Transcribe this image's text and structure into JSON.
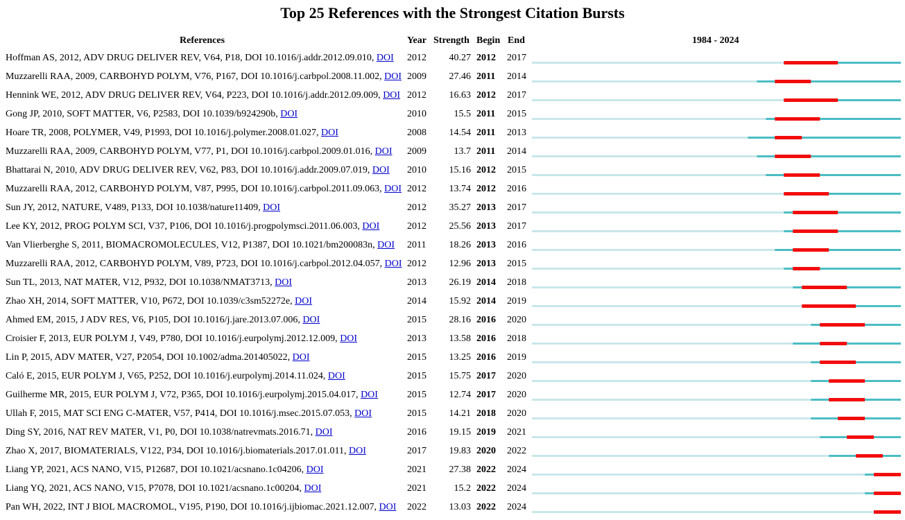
{
  "title": "Top 25 References with the Strongest Citation Bursts",
  "headers": {
    "references": "References",
    "year": "Year",
    "strength": "Strength",
    "begin": "Begin",
    "end": "End",
    "range": "1984 - 2024"
  },
  "colors": {
    "base": "#c9e7ea",
    "active": "#4bbdc4",
    "burst": "#f20d0d",
    "link": "#0000cc"
  },
  "chart_data": {
    "type": "table",
    "range": [
      1984,
      2024
    ],
    "rows": [
      {
        "ref": "Hoffman AS, 2012, ADV DRUG DELIVER REV, V64, P18, DOI 10.1016/j.addr.2012.09.010,",
        "link": "DOI",
        "year": "2012",
        "strength": "40.27",
        "begin": "2012",
        "end": "2017"
      },
      {
        "ref": "Muzzarelli RAA, 2009, CARBOHYD POLYM, V76, P167, DOI 10.1016/j.carbpol.2008.11.002,",
        "link": "DOI",
        "year": "2009",
        "strength": "27.46",
        "begin": "2011",
        "end": "2014"
      },
      {
        "ref": "Hennink WE, 2012, ADV DRUG DELIVER REV, V64, P223, DOI 10.1016/j.addr.2012.09.009,",
        "link": "DOI",
        "year": "2012",
        "strength": "16.63",
        "begin": "2012",
        "end": "2017"
      },
      {
        "ref": "Gong JP, 2010, SOFT MATTER, V6, P2583, DOI 10.1039/b924290b,",
        "link": "DOI",
        "year": "2010",
        "strength": "15.5",
        "begin": "2011",
        "end": "2015"
      },
      {
        "ref": "Hoare TR, 2008, POLYMER, V49, P1993, DOI 10.1016/j.polymer.2008.01.027,",
        "link": "DOI",
        "year": "2008",
        "strength": "14.54",
        "begin": "2011",
        "end": "2013"
      },
      {
        "ref": "Muzzarelli RAA, 2009, CARBOHYD POLYM, V77, P1, DOI 10.1016/j.carbpol.2009.01.016,",
        "link": "DOI",
        "year": "2009",
        "strength": "13.7",
        "begin": "2011",
        "end": "2014"
      },
      {
        "ref": "Bhattarai N, 2010, ADV DRUG DELIVER REV, V62, P83, DOI 10.1016/j.addr.2009.07.019,",
        "link": "DOI",
        "year": "2010",
        "strength": "15.16",
        "begin": "2012",
        "end": "2015"
      },
      {
        "ref": "Muzzarelli RAA, 2012, CARBOHYD POLYM, V87, P995, DOI 10.1016/j.carbpol.2011.09.063,",
        "link": "DOI",
        "year": "2012",
        "strength": "13.74",
        "begin": "2012",
        "end": "2016"
      },
      {
        "ref": "Sun JY, 2012, NATURE, V489, P133, DOI 10.1038/nature11409,",
        "link": "DOI",
        "year": "2012",
        "strength": "35.27",
        "begin": "2013",
        "end": "2017"
      },
      {
        "ref": "Lee KY, 2012, PROG POLYM SCI, V37, P106, DOI 10.1016/j.progpolymsci.2011.06.003,",
        "link": "DOI",
        "year": "2012",
        "strength": "25.56",
        "begin": "2013",
        "end": "2017"
      },
      {
        "ref": "Van Vlierberghe S, 2011, BIOMACROMOLECULES, V12, P1387, DOI 10.1021/bm200083n,",
        "link": "DOI",
        "year": "2011",
        "strength": "18.26",
        "begin": "2013",
        "end": "2016"
      },
      {
        "ref": "Muzzarelli RAA, 2012, CARBOHYD POLYM, V89, P723, DOI 10.1016/j.carbpol.2012.04.057,",
        "link": "DOI",
        "year": "2012",
        "strength": "12.96",
        "begin": "2013",
        "end": "2015"
      },
      {
        "ref": "Sun TL, 2013, NAT MATER, V12, P932, DOI 10.1038/NMAT3713,",
        "link": "DOI",
        "year": "2013",
        "strength": "26.19",
        "begin": "2014",
        "end": "2018"
      },
      {
        "ref": "Zhao XH, 2014, SOFT MATTER, V10, P672, DOI 10.1039/c3sm52272e,",
        "link": "DOI",
        "year": "2014",
        "strength": "15.92",
        "begin": "2014",
        "end": "2019"
      },
      {
        "ref": "Ahmed EM, 2015, J ADV RES, V6, P105, DOI 10.1016/j.jare.2013.07.006,",
        "link": "DOI",
        "year": "2015",
        "strength": "28.16",
        "begin": "2016",
        "end": "2020"
      },
      {
        "ref": "Croisier F, 2013, EUR POLYM J, V49, P780, DOI 10.1016/j.eurpolymj.2012.12.009,",
        "link": "DOI",
        "year": "2013",
        "strength": "13.58",
        "begin": "2016",
        "end": "2018"
      },
      {
        "ref": "Lin P, 2015, ADV MATER, V27, P2054, DOI 10.1002/adma.201405022,",
        "link": "DOI",
        "year": "2015",
        "strength": "13.25",
        "begin": "2016",
        "end": "2019"
      },
      {
        "ref": "Caló E, 2015, EUR POLYM J, V65, P252, DOI 10.1016/j.eurpolymj.2014.11.024,",
        "link": "DOI",
        "year": "2015",
        "strength": "15.75",
        "begin": "2017",
        "end": "2020"
      },
      {
        "ref": "Guilherme MR, 2015, EUR POLYM J, V72, P365, DOI 10.1016/j.eurpolymj.2015.04.017,",
        "link": "DOI",
        "year": "2015",
        "strength": "12.74",
        "begin": "2017",
        "end": "2020"
      },
      {
        "ref": "Ullah F, 2015, MAT SCI ENG C-MATER, V57, P414, DOI 10.1016/j.msec.2015.07.053,",
        "link": "DOI",
        "year": "2015",
        "strength": "14.21",
        "begin": "2018",
        "end": "2020"
      },
      {
        "ref": "Ding SY, 2016, NAT REV MATER, V1, P0, DOI 10.1038/natrevmats.2016.71,",
        "link": "DOI",
        "year": "2016",
        "strength": "19.15",
        "begin": "2019",
        "end": "2021"
      },
      {
        "ref": "Zhao X, 2017, BIOMATERIALS, V122, P34, DOI 10.1016/j.biomaterials.2017.01.011,",
        "link": "DOI",
        "year": "2017",
        "strength": "19.83",
        "begin": "2020",
        "end": "2022"
      },
      {
        "ref": "Liang YP, 2021, ACS NANO, V15, P12687, DOI 10.1021/acsnano.1c04206,",
        "link": "DOI",
        "year": "2021",
        "strength": "27.38",
        "begin": "2022",
        "end": "2024"
      },
      {
        "ref": "Liang YQ, 2021, ACS NANO, V15, P7078, DOI 10.1021/acsnano.1c00204,",
        "link": "DOI",
        "year": "2021",
        "strength": "15.2",
        "begin": "2022",
        "end": "2024"
      },
      {
        "ref": "Pan WH, 2022, INT J BIOL MACROMOL, V195, P190, DOI 10.1016/j.ijbiomac.2021.12.007,",
        "link": "DOI",
        "year": "2022",
        "strength": "13.03",
        "begin": "2022",
        "end": "2024"
      }
    ]
  }
}
